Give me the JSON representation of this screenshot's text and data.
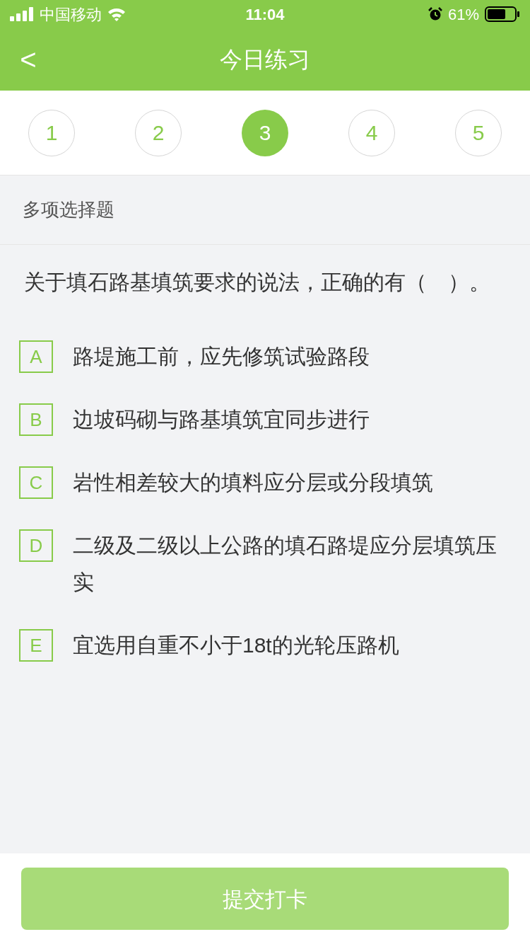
{
  "status_bar": {
    "carrier": "中国移动",
    "time": "11:04",
    "battery": "61%"
  },
  "header": {
    "back": "<",
    "title": "今日练习"
  },
  "steps": [
    {
      "label": "1",
      "selected": false
    },
    {
      "label": "2",
      "selected": false
    },
    {
      "label": "3",
      "selected": true
    },
    {
      "label": "4",
      "selected": false
    },
    {
      "label": "5",
      "selected": false
    }
  ],
  "question_type": "多项选择题",
  "question": "关于填石路基填筑要求的说法，正确的有（　）。",
  "options": [
    {
      "letter": "A",
      "text": "路堤施工前，应先修筑试验路段",
      "selected": false
    },
    {
      "letter": "B",
      "text": "边坡码砌与路基填筑宜同步进行",
      "selected": false
    },
    {
      "letter": "C",
      "text": "岩性相差较大的填料应分层或分段填筑",
      "selected": false
    },
    {
      "letter": "D",
      "text": "二级及二级以上公路的填石路堤应分层填筑压实",
      "selected": false
    },
    {
      "letter": "E",
      "text": "宜选用自重不小于18t的光轮压路机",
      "selected": false
    }
  ],
  "submit": {
    "label": "提交打卡",
    "disabled": true
  }
}
